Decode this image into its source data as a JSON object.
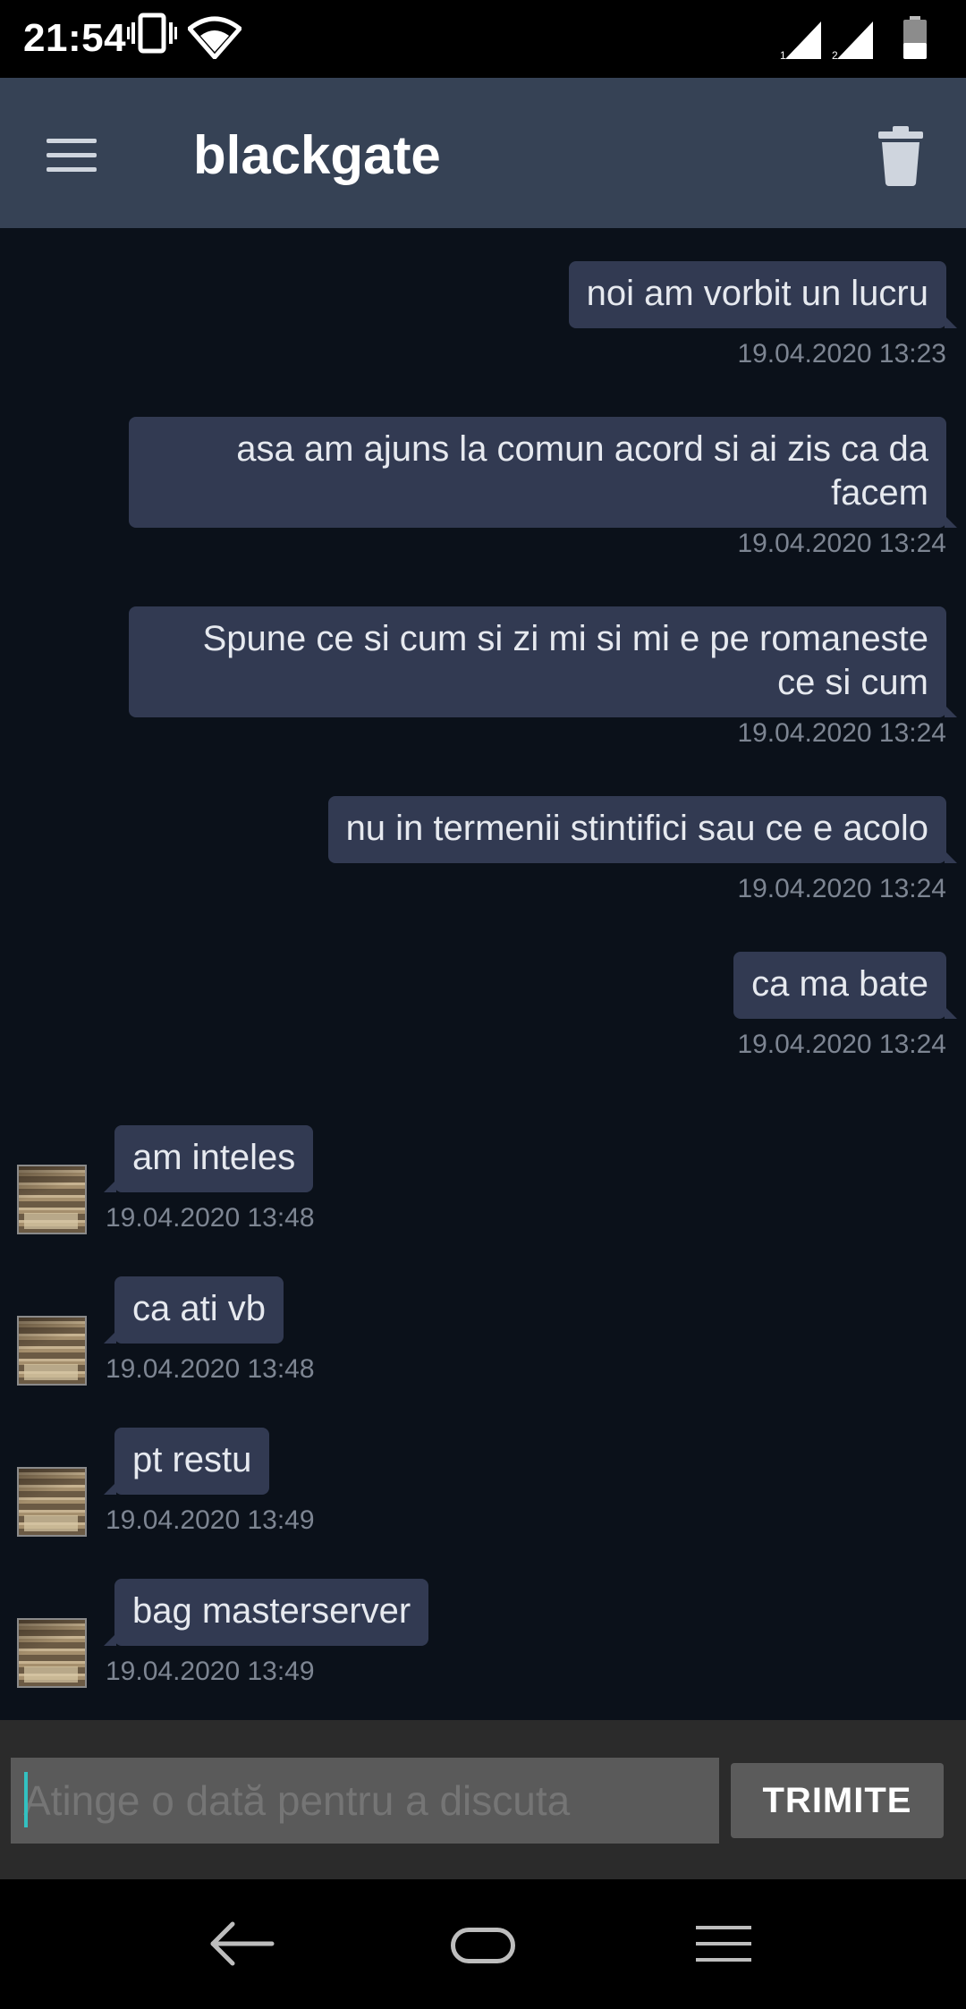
{
  "status_bar": {
    "time": "21:54",
    "icons": [
      "vibrate-icon",
      "wifi-icon",
      "signal-sim1-icon",
      "signal-sim2-icon",
      "battery-icon"
    ],
    "sim1_label": "1",
    "sim2_label": "2"
  },
  "app_bar": {
    "title": "blackgate",
    "menu_icon": "hamburger-menu-icon",
    "delete_icon": "trash-icon"
  },
  "messages": [
    {
      "direction": "out",
      "lines": [
        "noi am vorbit un lucru"
      ],
      "timestamp": "19.04.2020 13:23"
    },
    {
      "direction": "out",
      "lines": [
        "asa am ajuns la comun acord si ai zis ca da",
        "facem"
      ],
      "timestamp": "19.04.2020 13:24"
    },
    {
      "direction": "out",
      "lines": [
        "Spune ce si cum si zi mi si mi e pe romaneste",
        "ce si cum"
      ],
      "timestamp": "19.04.2020 13:24"
    },
    {
      "direction": "out",
      "lines": [
        "nu in termenii stintifici sau ce e acolo"
      ],
      "timestamp": "19.04.2020 13:24"
    },
    {
      "direction": "out",
      "lines": [
        "ca ma bate"
      ],
      "timestamp": "19.04.2020 13:24"
    },
    {
      "direction": "in",
      "lines": [
        "am inteles"
      ],
      "timestamp": "19.04.2020 13:48"
    },
    {
      "direction": "in",
      "lines": [
        "ca ati vb"
      ],
      "timestamp": "19.04.2020 13:48"
    },
    {
      "direction": "in",
      "lines": [
        "pt restu"
      ],
      "timestamp": "19.04.2020 13:49"
    },
    {
      "direction": "in",
      "lines": [
        "bag masterserver"
      ],
      "timestamp": "19.04.2020 13:49"
    }
  ],
  "composer": {
    "placeholder": "Atinge o dată pentru a discuta",
    "value": "",
    "send_label": "TRIMITE"
  },
  "nav_bar": {
    "icons": [
      "back-icon",
      "home-icon",
      "recents-icon"
    ]
  },
  "colors": {
    "app_bar": "#364255",
    "chat_background": "#0b111a",
    "bubble": "#323a52",
    "timestamp": "#7d8592",
    "composer_background": "#2b2b2b",
    "send_button": "#5b5b5b",
    "caret": "#33c1c1"
  }
}
